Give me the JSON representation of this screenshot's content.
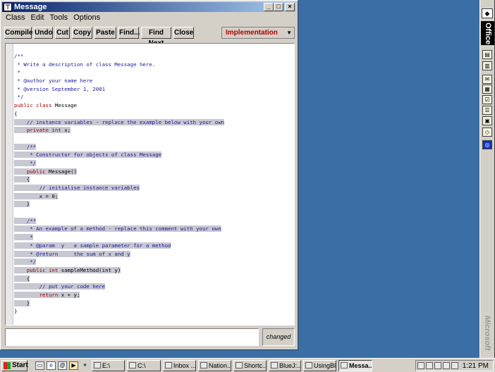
{
  "window": {
    "title": "Message",
    "icon_name": "bluej-icon",
    "buttons": {
      "minimize": "_",
      "maximize": "□",
      "close": "×"
    }
  },
  "menu": [
    "Class",
    "Edit",
    "Tools",
    "Options"
  ],
  "toolbar": {
    "buttons": [
      "Compile",
      "Undo",
      "Cut",
      "Copy",
      "Paste",
      "Find...",
      "Find Next",
      "Close"
    ],
    "view_selector": "Implementation"
  },
  "editor": {
    "lines": [
      "/**",
      " * Write a description of class Message here.",
      " *",
      " * @author your name here",
      " * @version September 1, 2001",
      " */",
      "public class Message",
      "{",
      "    // instance variables - replace the example below with your own",
      "    private int x;",
      "",
      "    /**",
      "     * Constructor for objects of class Message",
      "     */",
      "    public Message()",
      "    {",
      "        // initialise instance variables",
      "        x = 0;",
      "    }",
      "",
      "    /**",
      "     * An example of a method - replace this comment with your own",
      "     *",
      "     * @param  y   a sample parameter for a method",
      "     * @return     the sum of x and y",
      "     */",
      "    public int sampleMethod(int y)",
      "    {",
      "        // put your code here",
      "        return x + y;",
      "    }",
      "}"
    ]
  },
  "status": {
    "message": "",
    "changed_label": "changed"
  },
  "office_bar": {
    "title": "Office",
    "brand": "Microsoft"
  },
  "taskbar": {
    "start_label": "Start",
    "tasks": [
      "E:\\",
      "C:\\",
      "Inbox ...",
      "Nation...",
      "Shortc...",
      "BlueJ:...",
      "UsingBl...",
      "Messa..."
    ],
    "active_task": "Messa...",
    "clock": "1:21 PM"
  },
  "colors": {
    "desktop": "#3a6ea5",
    "titlebar": "#0a246a",
    "comment": "#1a1a9a",
    "keyword": "#a00000",
    "view_selector_text": "#b00000"
  }
}
